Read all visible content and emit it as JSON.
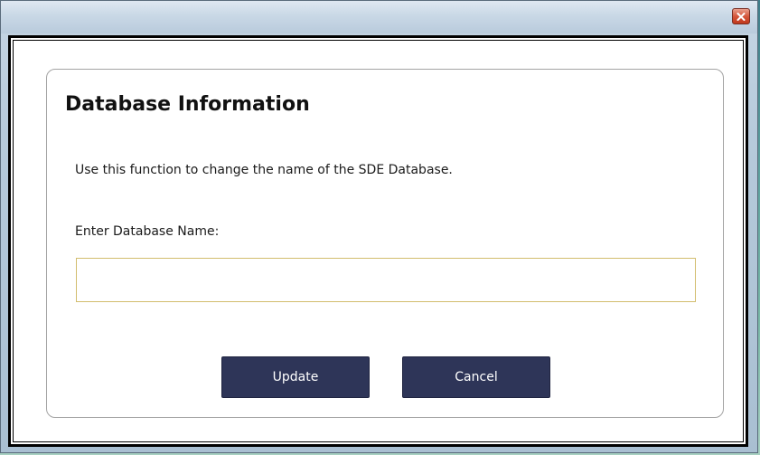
{
  "window": {
    "close_icon": "close-icon",
    "close_color": "#d5573c"
  },
  "dialog": {
    "title": "Database Information",
    "description": "Use this function to change the name of the SDE Database.",
    "field_label": "Enter Database Name:",
    "input_value": "",
    "input_placeholder": "",
    "update_label": "Update",
    "cancel_label": "Cancel",
    "button_color": "#2e3558"
  }
}
